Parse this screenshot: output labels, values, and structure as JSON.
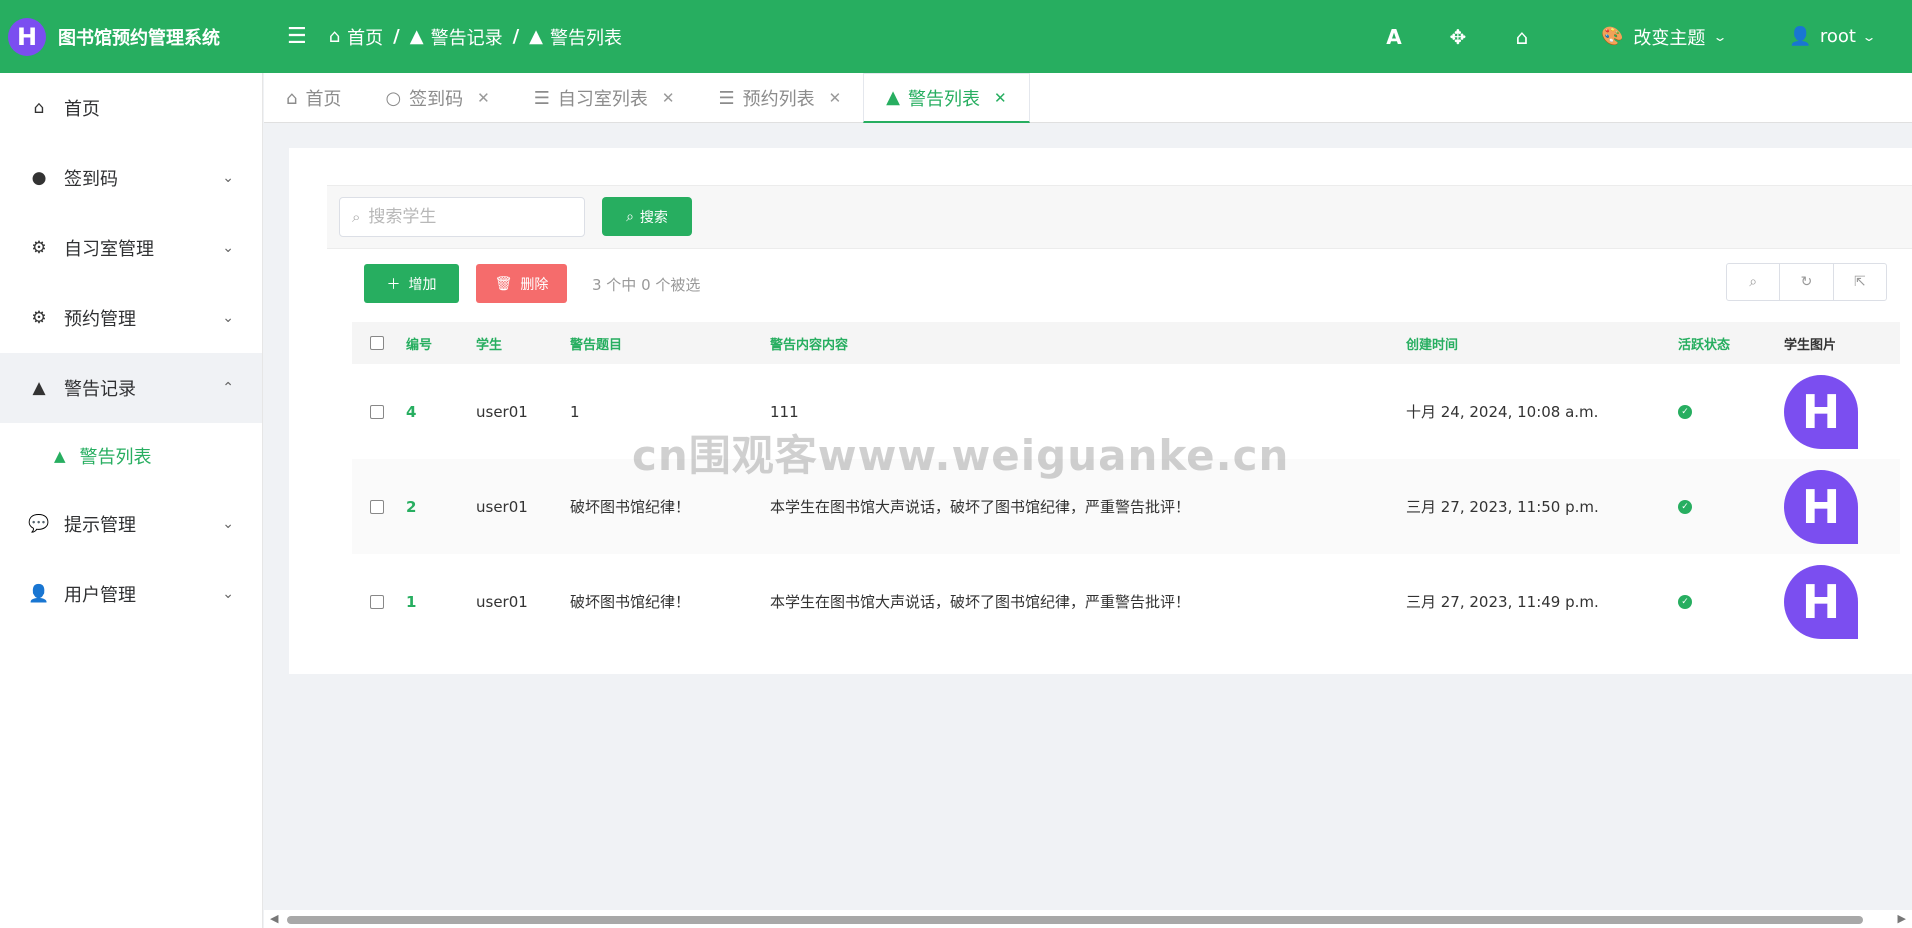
{
  "brand": {
    "logo_letter": "H",
    "title": "图书馆预约管理系统"
  },
  "breadcrumb": [
    "首页",
    "警告记录",
    "警告列表"
  ],
  "breadcrumb_sep": "/",
  "header": {
    "font_icon": "A",
    "theme_label": "改变主题",
    "user_name": "root"
  },
  "sidebar": {
    "items": [
      {
        "label": "首页",
        "icon": "home-icon",
        "has_arrow": false
      },
      {
        "label": "签到码",
        "icon": "dot-icon",
        "has_arrow": true
      },
      {
        "label": "自习室管理",
        "icon": "gear-icon",
        "has_arrow": true
      },
      {
        "label": "预约管理",
        "icon": "gear-icon",
        "has_arrow": true
      },
      {
        "label": "警告记录",
        "icon": "warning-icon",
        "has_arrow": true,
        "open": true
      },
      {
        "label": "提示管理",
        "icon": "chat-icon",
        "has_arrow": true
      },
      {
        "label": "用户管理",
        "icon": "user-gear-icon",
        "has_arrow": true
      }
    ],
    "sub_item": "警告列表"
  },
  "tabs": [
    {
      "label": "首页",
      "icon": "home-icon",
      "closable": false
    },
    {
      "label": "签到码",
      "icon": "circle-icon",
      "closable": true
    },
    {
      "label": "自习室列表",
      "icon": "list-icon",
      "closable": true
    },
    {
      "label": "预约列表",
      "icon": "list-icon",
      "closable": true
    },
    {
      "label": "警告列表",
      "icon": "warning-icon",
      "closable": true,
      "active": true
    }
  ],
  "search": {
    "placeholder": "搜索学生",
    "button": "搜索"
  },
  "toolbar": {
    "add": "增加",
    "delete": "删除",
    "selection_info": "3 个中 0 个被选"
  },
  "table": {
    "headers": [
      "编号",
      "学生",
      "警告题目",
      "警告内容内容",
      "创建时间",
      "活跃状态",
      "学生图片"
    ],
    "rows": [
      {
        "id": "4",
        "student": "user01",
        "title": "1",
        "content": "111",
        "time": "十月 24, 2024, 10:08 a.m.",
        "avatar": "H"
      },
      {
        "id": "2",
        "student": "user01",
        "title": "破坏图书馆纪律！",
        "content": "本学生在图书馆大声说话，破坏了图书馆纪律，严重警告批评！",
        "time": "三月 27, 2023, 11:50 p.m.",
        "avatar": "H"
      },
      {
        "id": "1",
        "student": "user01",
        "title": "破坏图书馆纪律！",
        "content": "本学生在图书馆大声说话，破坏了图书馆纪律，严重警告批评！",
        "time": "三月 27, 2023, 11:49 p.m.",
        "avatar": "H"
      }
    ]
  },
  "watermark": "cn围观客www.weiguanke.cn",
  "colors": {
    "primary": "#27ae60",
    "danger": "#f56c6c",
    "avatar": "#7b4ef0"
  }
}
